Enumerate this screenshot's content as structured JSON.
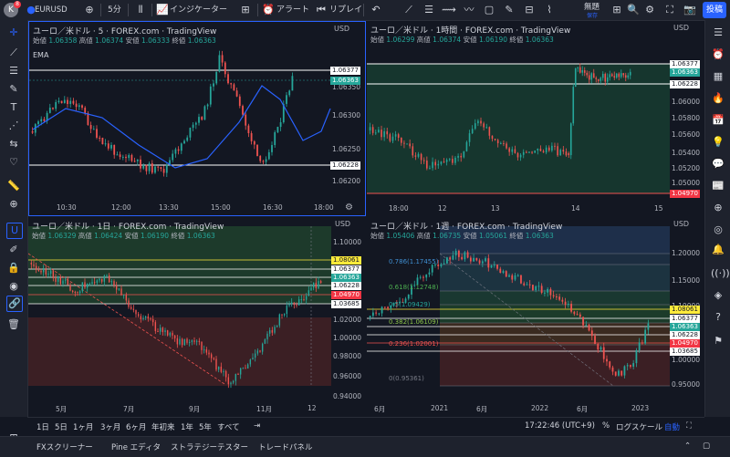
{
  "topbar": {
    "avatar_letter": "K",
    "badge_count": "8",
    "symbol": "EURUSD",
    "interval": "5分",
    "indicators_label": "インジケーター",
    "alert_label": "アラート",
    "replay_label": "リプレイ",
    "layout_name": "無題",
    "layout_sub": "保存",
    "post_label": "投稿"
  },
  "panes": [
    {
      "title": "ユーロ／米ドル · 5 · FOREX.com · TradingView",
      "o_label": "始値",
      "o": "1.06358",
      "h_label": "高値",
      "h": "1.06374",
      "l_label": "安値",
      "l": "1.06333",
      "c_label": "終値",
      "c": "1.06363",
      "ema_label": "EMA",
      "currency": "USD",
      "price_ticks": [
        "1.06350",
        "1.06300",
        "1.06250",
        "1.06200"
      ],
      "price_labels": [
        "1.06377",
        "1.06363",
        "1.06228"
      ],
      "time_ticks": [
        "10:30",
        "12:00",
        "13:30",
        "15:00",
        "16:30",
        "18:00"
      ]
    },
    {
      "title": "ユーロ／米ドル · 1時間 · FOREX.com · TradingView",
      "o_label": "始値",
      "o": "1.06299",
      "h_label": "高値",
      "h": "1.06374",
      "l_label": "安値",
      "l": "1.06190",
      "c_label": "終値",
      "c": "1.06363",
      "currency": "USD",
      "price_ticks": [
        "1.06000",
        "1.05800",
        "1.05600",
        "1.05400",
        "1.05200",
        "1.05000"
      ],
      "price_labels": [
        "1.06377",
        "1.06363",
        "1.06228",
        "1.04970"
      ],
      "time_ticks": [
        "18:00",
        "12",
        "13",
        "14",
        "15"
      ]
    },
    {
      "title": "ユーロ／米ドル · 1日 · FOREX.com · TradingView",
      "o_label": "始値",
      "o": "1.06329",
      "h_label": "高値",
      "h": "1.06424",
      "l_label": "安値",
      "l": "1.06190",
      "c_label": "終値",
      "c": "1.06363",
      "currency": "USD",
      "price_ticks": [
        "1.10000",
        "1.08000",
        "1.02000",
        "1.00000",
        "0.98000",
        "0.96000",
        "0.94000"
      ],
      "price_labels": [
        "1.08061",
        "1.06377",
        "1.06363",
        "1.06228",
        "1.04970",
        "1.03685"
      ],
      "time_ticks": [
        "5月",
        "7月",
        "9月",
        "11月",
        "12"
      ]
    },
    {
      "title": "ユーロ／米ドル · 1週 · FOREX.com · TradingView",
      "o_label": "始値",
      "o": "1.05406",
      "h_label": "高値",
      "h": "1.06735",
      "l_label": "安値",
      "l": "1.05061",
      "c_label": "終値",
      "c": "1.06363",
      "currency": "USD",
      "price_ticks": [
        "1.20000",
        "1.15000",
        "1.10000",
        "1.00000",
        "0.95000"
      ],
      "price_labels": [
        "1.08061",
        "1.06377",
        "1.06363",
        "1.06228",
        "1.04970",
        "1.03685"
      ],
      "time_ticks": [
        "6月",
        "2021",
        "6月",
        "2022",
        "6月",
        "2023"
      ],
      "fib_labels": [
        "0.786(1.17455)",
        "0.618(1.12748)",
        "0.5(1.09429)",
        "0.382(1.06109)",
        "0.236(1.02001)",
        "0(0.95361)"
      ]
    }
  ],
  "bottombar": {
    "ranges": [
      "1日",
      "5日",
      "1ヶ月",
      "3ヶ月",
      "6ヶ月",
      "年初来",
      "1年",
      "5年",
      "すべて"
    ],
    "time": "17:22:46 (UTC+9)",
    "percent": "%",
    "log": "ログスケール",
    "auto": "自動"
  },
  "footer": {
    "tabs": [
      "FXスクリーナー",
      "Pine エディタ",
      "ストラテジーテスター",
      "トレードパネル"
    ]
  },
  "colors": {
    "bg": "#131722",
    "up": "#26a69a",
    "down": "#ef5350",
    "accent": "#2962ff",
    "ema": "#2962ff"
  }
}
